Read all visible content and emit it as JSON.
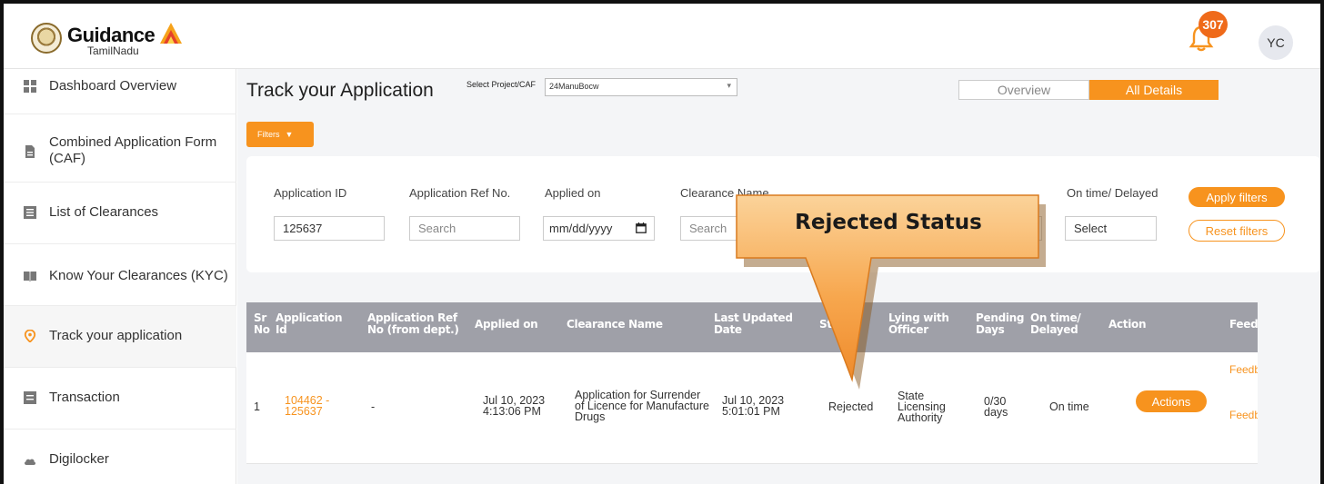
{
  "header": {
    "logo_main": "Guidance",
    "logo_sub": "TamilNadu",
    "notification_count": "307",
    "avatar_initials": "YC"
  },
  "sidebar": {
    "items": [
      {
        "label": "Dashboard Overview",
        "icon": "grid-icon"
      },
      {
        "label": "Combined Application Form (CAF)",
        "icon": "document-icon"
      },
      {
        "label": "List of Clearances",
        "icon": "list-icon"
      },
      {
        "label": "Know Your Clearances (KYC)",
        "icon": "book-icon"
      },
      {
        "label": "Track your application",
        "icon": "location-pin-icon"
      },
      {
        "label": "Transaction",
        "icon": "receipt-icon"
      },
      {
        "label": "Digilocker",
        "icon": "cloud-icon"
      }
    ]
  },
  "main": {
    "title": "Track your Application",
    "select_label": "Select Project/CAF",
    "select_value": "24ManuBocw",
    "tabs": [
      {
        "label": "Overview",
        "active": false
      },
      {
        "label": "All Details",
        "active": true
      }
    ],
    "filters_button": "Filters",
    "filters": {
      "application_id_label": "Application ID",
      "application_id_value": "125637",
      "ref_no_label": "Application Ref No.",
      "ref_no_placeholder": "Search",
      "applied_on_label": "Applied on",
      "applied_on_placeholder": "mm/dd/yyyy",
      "clearance_name_label": "Clearance Name",
      "clearance_name_placeholder": "Search",
      "on_time_label": "On time/ Delayed",
      "on_time_placeholder": "Select",
      "apply_label": "Apply filters",
      "reset_label": "Reset filters"
    },
    "table": {
      "headers": [
        "Sr No",
        "Application Id",
        "Application Ref No (from dept.)",
        "Applied on",
        "Clearance Name",
        "Last Updated Date",
        "Status",
        "Lying with Officer",
        "Pending Days",
        "On time/ Delayed",
        "Action",
        "Feedback"
      ],
      "rows": [
        {
          "sr_no": "1",
          "application_id": "104462 - 125637",
          "ref_no": "-",
          "applied_on": "Jul 10, 2023 4:13:06 PM",
          "clearance_name": "Application for Surrender of Licence for Manufacture Drugs",
          "last_updated": "Jul 10, 2023 5:01:01 PM",
          "status": "Rejected",
          "lying_with": "State Licensing Authority",
          "pending_days": "0/30 days",
          "on_time": "On time",
          "action": "Actions",
          "feedback_1": "Feedback Application Process",
          "feedback_2": "Feedback Application Submission"
        }
      ]
    }
  },
  "callout": {
    "text": "Rejected Status"
  },
  "colors": {
    "accent": "#f7931e",
    "badge": "#ef6a1a",
    "table_header": "#9fa0a8"
  }
}
